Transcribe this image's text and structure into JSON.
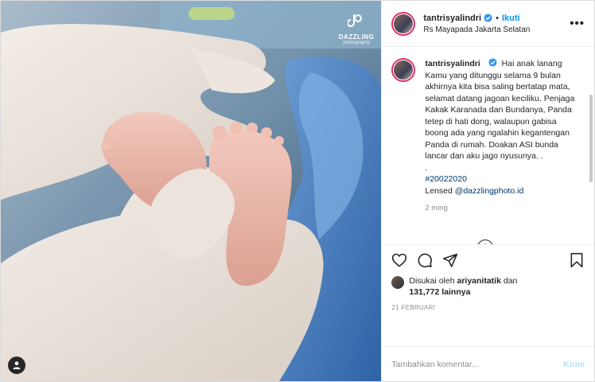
{
  "photo": {
    "watermark_brand": "DAZZLING",
    "watermark_sub": "photography"
  },
  "header": {
    "username": "tantrisyalindri",
    "separator": "•",
    "follow_label": "Ikuti",
    "location": "Rs Mayapada Jakarta Selatan",
    "more_label": "•••"
  },
  "caption": {
    "username": "tantrisyalindri",
    "text": "Hai anak lanang Kamu yang ditunggu selama 9 bulan akhirnya kita bisa saling bertatap mata, selamat datang jagoan keciliku. Penjaga Kakak Karanada dan Bundanya, Panda tetep di hati dong, walaupun gabisa boong ada yang ngalahin kegantengan Panda di rumah. Doakan ASI bunda lancar dan aku jago nyusunya. .",
    "dot_line": ".",
    "hashtag": "#20022020",
    "lensed_label": "Lensed",
    "mention": "@dazzlingphoto.id",
    "time": "2 ming"
  },
  "likes": {
    "prefix": "Disukai oleh",
    "user": "ariyanitatik",
    "and": "dan",
    "count": "131,772 lainnya"
  },
  "date": "21 FEBRUARI",
  "comment_box": {
    "placeholder": "Tambahkan komentar...",
    "post_label": "Kirim"
  },
  "icons": {
    "verified": "verified-badge-icon",
    "like": "heart-icon",
    "comment": "comment-bubble-icon",
    "share": "paper-plane-icon",
    "save": "bookmark-icon",
    "load_more": "plus-circle-icon",
    "user_tag": "person-icon",
    "watermark": "dazzling-logo-icon"
  },
  "colors": {
    "link_blue": "#0095f6",
    "hashtag": "#00376b",
    "muted": "#8e8e8e",
    "border": "#dbdbdb",
    "story_ring": "#e1306c"
  }
}
